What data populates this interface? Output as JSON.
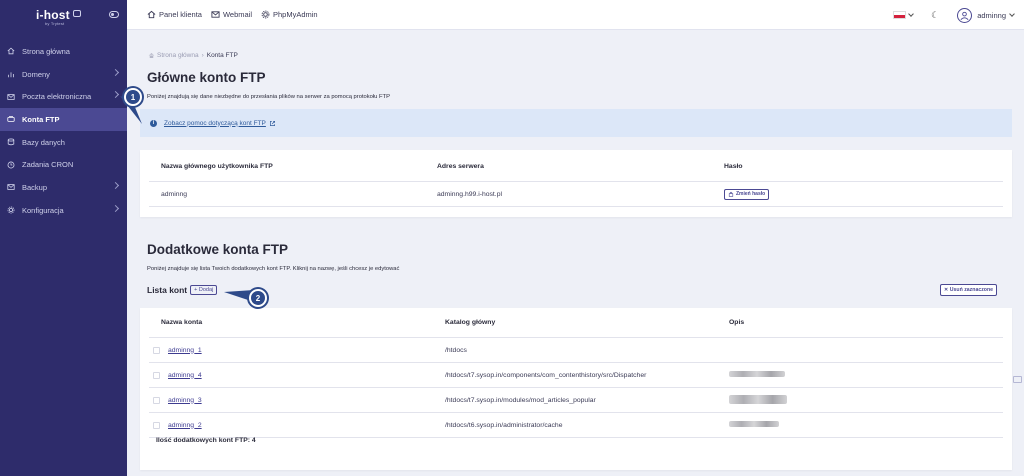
{
  "app": {
    "logo": "i-host",
    "logo_sub": "by Trytest"
  },
  "sidebar": {
    "items": [
      {
        "label": "Strona główna",
        "icon": "home-icon",
        "chevron": false
      },
      {
        "label": "Domeny",
        "icon": "chart-icon",
        "chevron": true
      },
      {
        "label": "Poczta elektroniczna",
        "icon": "mail-icon",
        "chevron": true
      },
      {
        "label": "Konta FTP",
        "icon": "ftp-icon",
        "chevron": false,
        "active": true
      },
      {
        "label": "Bazy danych",
        "icon": "database-icon",
        "chevron": false
      },
      {
        "label": "Zadania CRON",
        "icon": "clock-icon",
        "chevron": false
      },
      {
        "label": "Backup",
        "icon": "backup-icon",
        "chevron": true
      },
      {
        "label": "Konfiguracja",
        "icon": "gear-icon",
        "chevron": true
      }
    ]
  },
  "topbar": {
    "links": [
      {
        "label": "Panel klienta",
        "icon": "home-icon"
      },
      {
        "label": "Webmail",
        "icon": "mail-icon"
      },
      {
        "label": "PhpMyAdmin",
        "icon": "gear-icon"
      }
    ],
    "username": "adminng"
  },
  "breadcrumb": {
    "root": "Strona główna",
    "sep": "›",
    "current": "Konta FTP"
  },
  "main_account": {
    "title": "Główne konto FTP",
    "description": "Poniżej znajdują się dane niezbędne do przesłania plików na serwer za pomocą protokołu FTP",
    "help_link": "Zobacz pomoc dotyczącą kont FTP",
    "headers": [
      "Nazwa głównego użytkownika FTP",
      "Adres serwera",
      "Hasło"
    ],
    "username": "adminng",
    "server": "adminng.h99.i-host.pl",
    "change_password": "Zmień hasło"
  },
  "additional": {
    "title": "Dodatkowe konta FTP",
    "description": "Poniżej znajduje się lista Twoich dodatkowych kont FTP. Kliknij na nazwę, jeśli chcesz je edytować",
    "list_title": "Lista kont",
    "add_label": "+ Dodaj",
    "delete_selected": "✕  Usuń zaznaczone",
    "headers": [
      "Nazwa konta",
      "Katalog główny",
      "Opis"
    ],
    "rows": [
      {
        "name": "adminng_1",
        "dir": "/htdocs",
        "desc_blurred": false
      },
      {
        "name": "adminng_4",
        "dir": "/htdocs/t7.sysop.in/components/com_contenthistory/src/Dispatcher",
        "desc_blurred": true
      },
      {
        "name": "adminng_3",
        "dir": "/htdocs/t7.sysop.in/modules/mod_articles_popular",
        "desc_blurred": true
      },
      {
        "name": "adminng_2",
        "dir": "/htdocs/t6.sysop.in/administrator/cache",
        "desc_blurred": true
      }
    ],
    "count_label": "Ilość dodatkowych kont FTP: 4"
  },
  "steps": {
    "one": "1",
    "two": "2"
  },
  "colors": {
    "sidebar": "#2e2c6b",
    "active": "#4b4993",
    "info": "#dce7f8",
    "step": "#2e4a8a"
  }
}
